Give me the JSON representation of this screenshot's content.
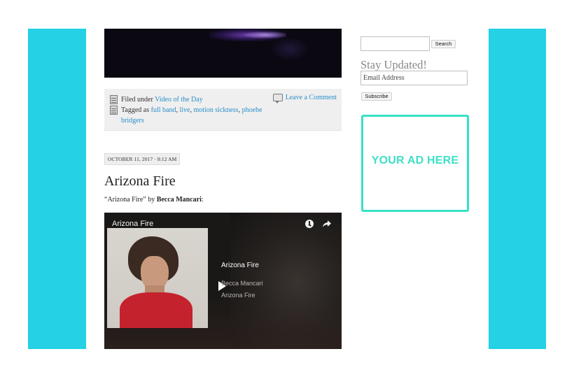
{
  "post_meta": {
    "filed_under_label": "Filed under",
    "category": "Video of the Day",
    "comment_link": "Leave a Comment",
    "tagged_as_label": "Tagged as",
    "tags": [
      "full band",
      "live",
      "motion sickness",
      "phoebe bridgers"
    ]
  },
  "post": {
    "date": "OCTOBER 11, 2017 · 8:12 AM",
    "title": "Arizona Fire",
    "intro_quote": "“Arizona Fire” by",
    "intro_artist": "Becca Mancari",
    "intro_suffix": ":"
  },
  "embed": {
    "title": "Arizona Fire",
    "track_title": "Arizona Fire",
    "track_artist": "Becca Mancari",
    "track_album": "Arizona Fire"
  },
  "sidebar": {
    "search_button": "Search",
    "stay_updated_heading": "Stay Updated!",
    "email_placeholder": "Email Address",
    "subscribe_button": "Subscribe",
    "ad_text": "YOUR AD HERE"
  },
  "colors": {
    "frame_cyan": "#24d1e5",
    "ad_accent": "#3ee0c8",
    "link_blue": "#2a8ec8"
  }
}
